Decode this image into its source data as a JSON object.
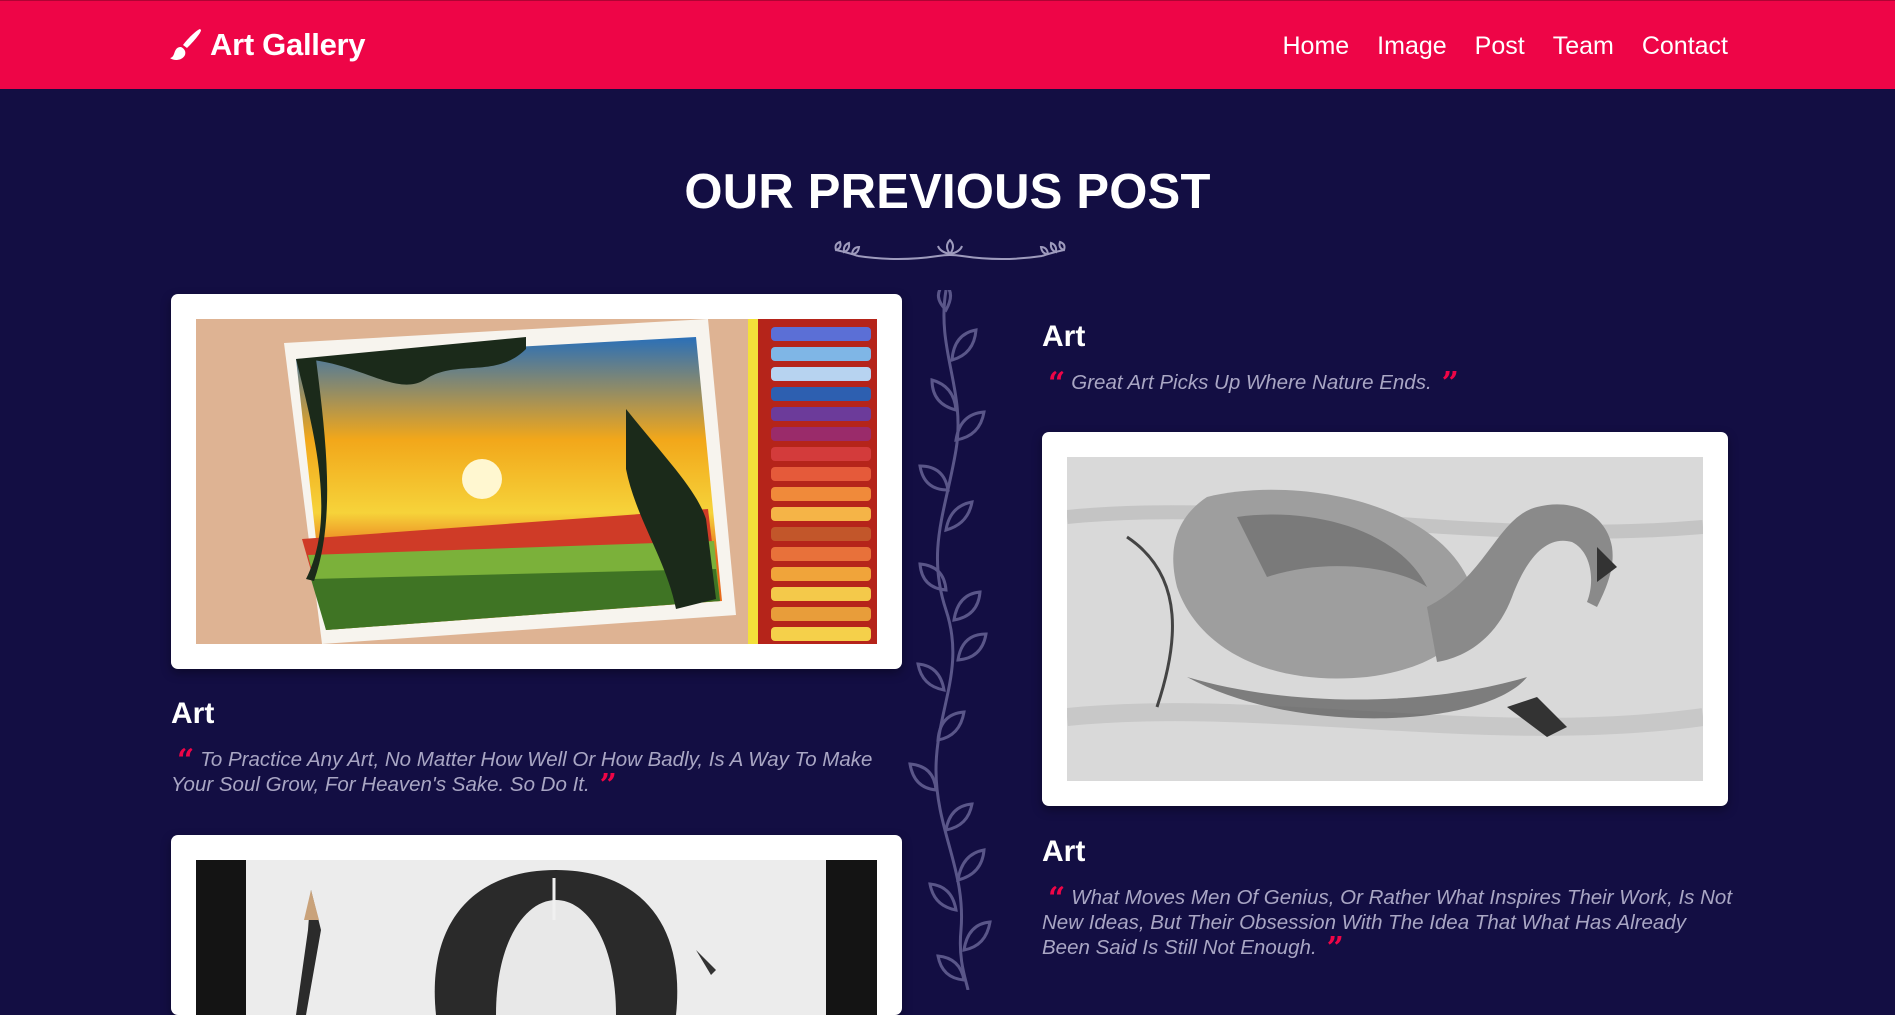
{
  "navbar": {
    "brand": "Art Gallery",
    "brand_icon": "paint-brush-icon",
    "links": [
      {
        "label": "Home"
      },
      {
        "label": "Image"
      },
      {
        "label": "Post"
      },
      {
        "label": "Team"
      },
      {
        "label": "Contact"
      }
    ]
  },
  "section": {
    "title": "OUR PREVIOUS POST"
  },
  "posts": [
    {
      "title": "Art",
      "quote": "To Practice Any Art, No Matter How Well Or How Badly, Is A Way To Make Your Soul Grow, For Heaven's Sake. So Do It.",
      "image": "sunset landscape painting with oil pastels"
    },
    {
      "title": "Art",
      "quote": "Great Art Picks Up Where Nature Ends."
    },
    {
      "image": "pencil sketch of a swan"
    },
    {
      "title": "Art",
      "quote": "What Moves Men Of Genius, Or Rather What Inspires Their Work, Is Not New Ideas, But Their Obsession With The Idea That What Has Already Been Said Is Still Not Enough."
    },
    {
      "image": "pencil portrait drawing of a woman"
    }
  ],
  "colors": {
    "navbar": "#ee0547",
    "background": "#130e43",
    "accent": "#ee0547",
    "quote_text": "#a9a6c4"
  }
}
